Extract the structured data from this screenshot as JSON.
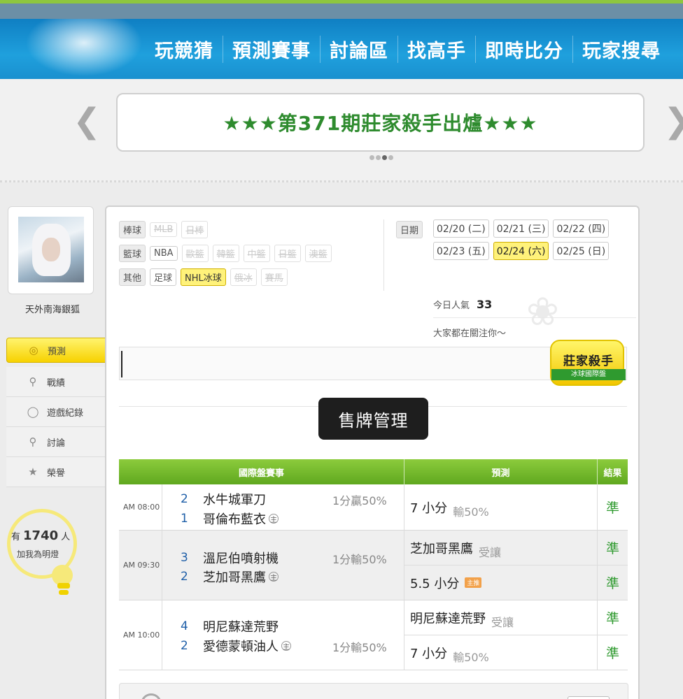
{
  "nav": {
    "items": [
      "玩競猜",
      "預測賽事",
      "討論區",
      "找高手",
      "即時比分",
      "玩家搜尋"
    ]
  },
  "banner": {
    "text": "★★★第371期莊家殺手出爐★★★",
    "prev_icon": "chevron-left",
    "next_icon": "chevron-right"
  },
  "profile": {
    "name": "天外南海銀狐"
  },
  "sidebar": {
    "items": [
      {
        "label": "預測",
        "icon": "target-icon"
      },
      {
        "label": "戰績",
        "icon": "chart-icon"
      },
      {
        "label": "遊戲紀錄",
        "icon": "circle-icon"
      },
      {
        "label": "討論",
        "icon": "chat-icon"
      },
      {
        "label": "榮譽",
        "icon": "medal-icon"
      }
    ]
  },
  "fans": {
    "prefix": "有",
    "count": "1740",
    "suffix": "人",
    "subtitle": "加我為明燈"
  },
  "filters": {
    "baseball_label": "棒球",
    "baseball": [
      "MLB",
      "日棒"
    ],
    "basketball_label": "籃球",
    "basketball": [
      "NBA",
      "歐籃",
      "韓籃",
      "中籃",
      "日籃",
      "澳籃"
    ],
    "other_label": "其他",
    "other": [
      "足球",
      "NHL冰球",
      "俄冰",
      "賽馬"
    ]
  },
  "dates": {
    "label": "日期",
    "items": [
      "02/20 (二)",
      "02/21 (三)",
      "02/22 (四)",
      "02/23 (五)",
      "02/24 (六)",
      "02/25 (日)"
    ],
    "selected": "02/24 (六)"
  },
  "popularity": {
    "label": "今日人氣",
    "value": "33",
    "watching": "大家都在關注你～"
  },
  "badge": {
    "title": "莊家殺手",
    "subtitle": "冰球國際盤"
  },
  "tooltip": "售牌管理",
  "table": {
    "headers": [
      "國際盤賽事",
      "預測",
      "結果"
    ],
    "games": [
      {
        "time": "AM 08:00",
        "away_no": "2",
        "away": "水牛城軍刀",
        "home_no": "1",
        "home": "哥倫布藍衣",
        "home_mark": "主",
        "odds": "1分贏50%",
        "preds": [
          {
            "main": "7 小分",
            "sub": "輸50%",
            "result": "準"
          }
        ]
      },
      {
        "time": "AM 09:30",
        "away_no": "3",
        "away": "溫尼伯噴射機",
        "home_no": "2",
        "home": "芝加哥黑鷹",
        "home_mark": "主",
        "odds": "1分輸50%",
        "preds": [
          {
            "main": "芝加哥黑鷹",
            "sub": "受讓",
            "result": "準"
          },
          {
            "main": "5.5 小分",
            "sub": "",
            "mini": "主推",
            "result": "準"
          }
        ]
      },
      {
        "time": "AM 10:00",
        "away_no": "4",
        "away": "明尼蘇達荒野",
        "home_no": "2",
        "home": "愛德蒙頓油人",
        "home_mark": "主",
        "odds": "1分輸50%",
        "preds": [
          {
            "main": "明尼蘇達荒野",
            "sub": "受讓",
            "result": "準"
          },
          {
            "main": "7 小分",
            "sub": "輸50%",
            "result": "準"
          }
        ]
      }
    ]
  }
}
